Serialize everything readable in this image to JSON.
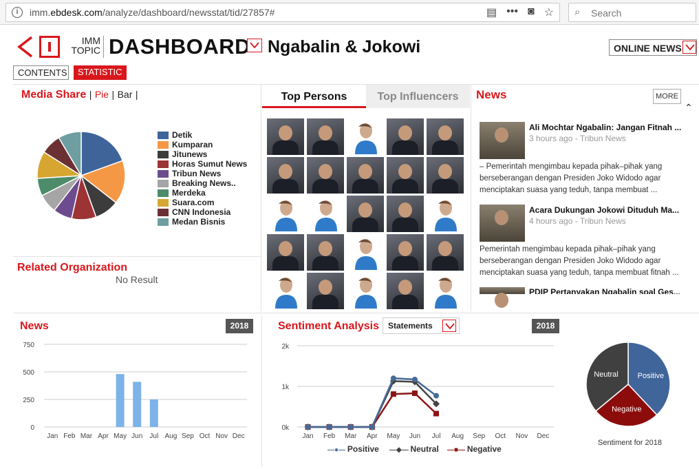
{
  "browser": {
    "url_prefix": "imm.",
    "url_domain": "ebdesk.com",
    "url_path": "/analyze/dashboard/newsstat/tid/27857#",
    "search_placeholder": "Search",
    "icons": [
      "info-icon",
      "reader-view-icon",
      "more-actions-icon",
      "pocket-icon",
      "bookmark-star-icon",
      "search-icon"
    ]
  },
  "header": {
    "brand_line1": "IMM",
    "brand_line2": "TOPIC",
    "dashboard_label": "DASHBOARD",
    "topic_title": "Ngabalin & Jokowi",
    "source_select": "ONLINE NEWS",
    "tabs": [
      {
        "label": "CONTENTS",
        "active": false
      },
      {
        "label": "STATISTIC",
        "active": true
      }
    ],
    "accent_color": "#d8171c"
  },
  "media_share": {
    "title": "Media Share",
    "view_pie": "Pie",
    "view_bar": "Bar",
    "sep": "|"
  },
  "related_org": {
    "title": "Related Organization",
    "empty_text": "No Result"
  },
  "top_persons": {
    "tab_active": "Top Persons",
    "tab_inactive": "Top Influencers"
  },
  "news_panel": {
    "title": "News",
    "more_label": "MORE",
    "items": [
      {
        "title": "Ali Mochtar Ngabalin: Jangan Fitnah ...",
        "meta": "3 hours ago - Tribun News",
        "body": "– Pemerintah mengimbau kepada pihak–pihak yang berseberangan dengan Presiden Joko Widodo agar menciptakan suasa yang teduh, tanpa membuat ..."
      },
      {
        "title": "Acara Dukungan Jokowi Dituduh Ma...",
        "meta": "4 hours ago - Tribun News",
        "body": "Pemerintah mengimbau kepada pihak–pihak yang berseberangan dengan Presiden Joko Widodo agar menciptakan suasa yang teduh, tanpa membuat fitnah ..."
      },
      {
        "title": "PDIP Pertanyakan Ngabalin soal Ges...",
        "meta": "",
        "body": ""
      }
    ]
  },
  "news_chart_panel": {
    "title": "News",
    "year": "2018"
  },
  "sentiment_panel": {
    "title": "Sentiment Analysis",
    "select": "Statements",
    "year": "2018",
    "pie_caption": "Sentiment for 2018"
  },
  "chart_data": [
    {
      "type": "pie",
      "title": "Media Share",
      "labels": [
        "Detik",
        "Kumparan",
        "Jitunews",
        "Horas Sumut News",
        "Tribun News",
        "Breaking News..",
        "Merdeka",
        "Suara.com",
        "CNN Indonesia",
        "Medan Bisnis"
      ],
      "values": [
        19.5,
        16,
        9,
        9,
        7,
        7,
        6.5,
        10,
        7.5,
        8.5
      ],
      "colors": [
        "#3f649a",
        "#f59845",
        "#3c3c3c",
        "#9c3335",
        "#6c4c8e",
        "#a5a5a5",
        "#4c8c6a",
        "#d6a631",
        "#6b3033",
        "#6e9ea1"
      ],
      "legend": "right"
    },
    {
      "type": "bar",
      "title": "News",
      "categories": [
        "Jan",
        "Feb",
        "Mar",
        "Apr",
        "May",
        "Jun",
        "Jul",
        "Aug",
        "Sep",
        "Oct",
        "Nov",
        "Dec"
      ],
      "values": [
        0,
        0,
        0,
        0,
        480,
        410,
        250,
        0,
        0,
        0,
        0,
        0
      ],
      "yticks": [
        "0",
        "250",
        "500",
        "750"
      ],
      "ylim": [
        0,
        750
      ],
      "color": "#7db3e8",
      "grid": true
    },
    {
      "type": "line",
      "title": "Sentiment Analysis",
      "categories": [
        "Jan",
        "Feb",
        "Mar",
        "Apr",
        "May",
        "Jun",
        "Jul",
        "Aug",
        "Sep",
        "Oct",
        "Nov",
        "Dec"
      ],
      "yticks": [
        "0k",
        "1k",
        "2k"
      ],
      "ylim": [
        0,
        2000
      ],
      "series": [
        {
          "name": "Positive",
          "values": [
            0,
            0,
            0,
            0,
            1200,
            1170,
            770
          ],
          "color": "#466a97",
          "marker": "circle"
        },
        {
          "name": "Neutral",
          "values": [
            0,
            0,
            0,
            0,
            1130,
            1110,
            570
          ],
          "color": "#444444",
          "marker": "diamond"
        },
        {
          "name": "Negative",
          "values": [
            0,
            0,
            0,
            0,
            810,
            830,
            330
          ],
          "color": "#8b1414",
          "marker": "square"
        }
      ],
      "legend": "bottom",
      "grid": true
    },
    {
      "type": "pie",
      "title": "Sentiment for 2018",
      "labels": [
        "Positive",
        "Negative",
        "Neutral"
      ],
      "values": [
        38,
        26,
        36
      ],
      "colors": [
        "#40659a",
        "#8c0c0c",
        "#404040"
      ]
    }
  ]
}
